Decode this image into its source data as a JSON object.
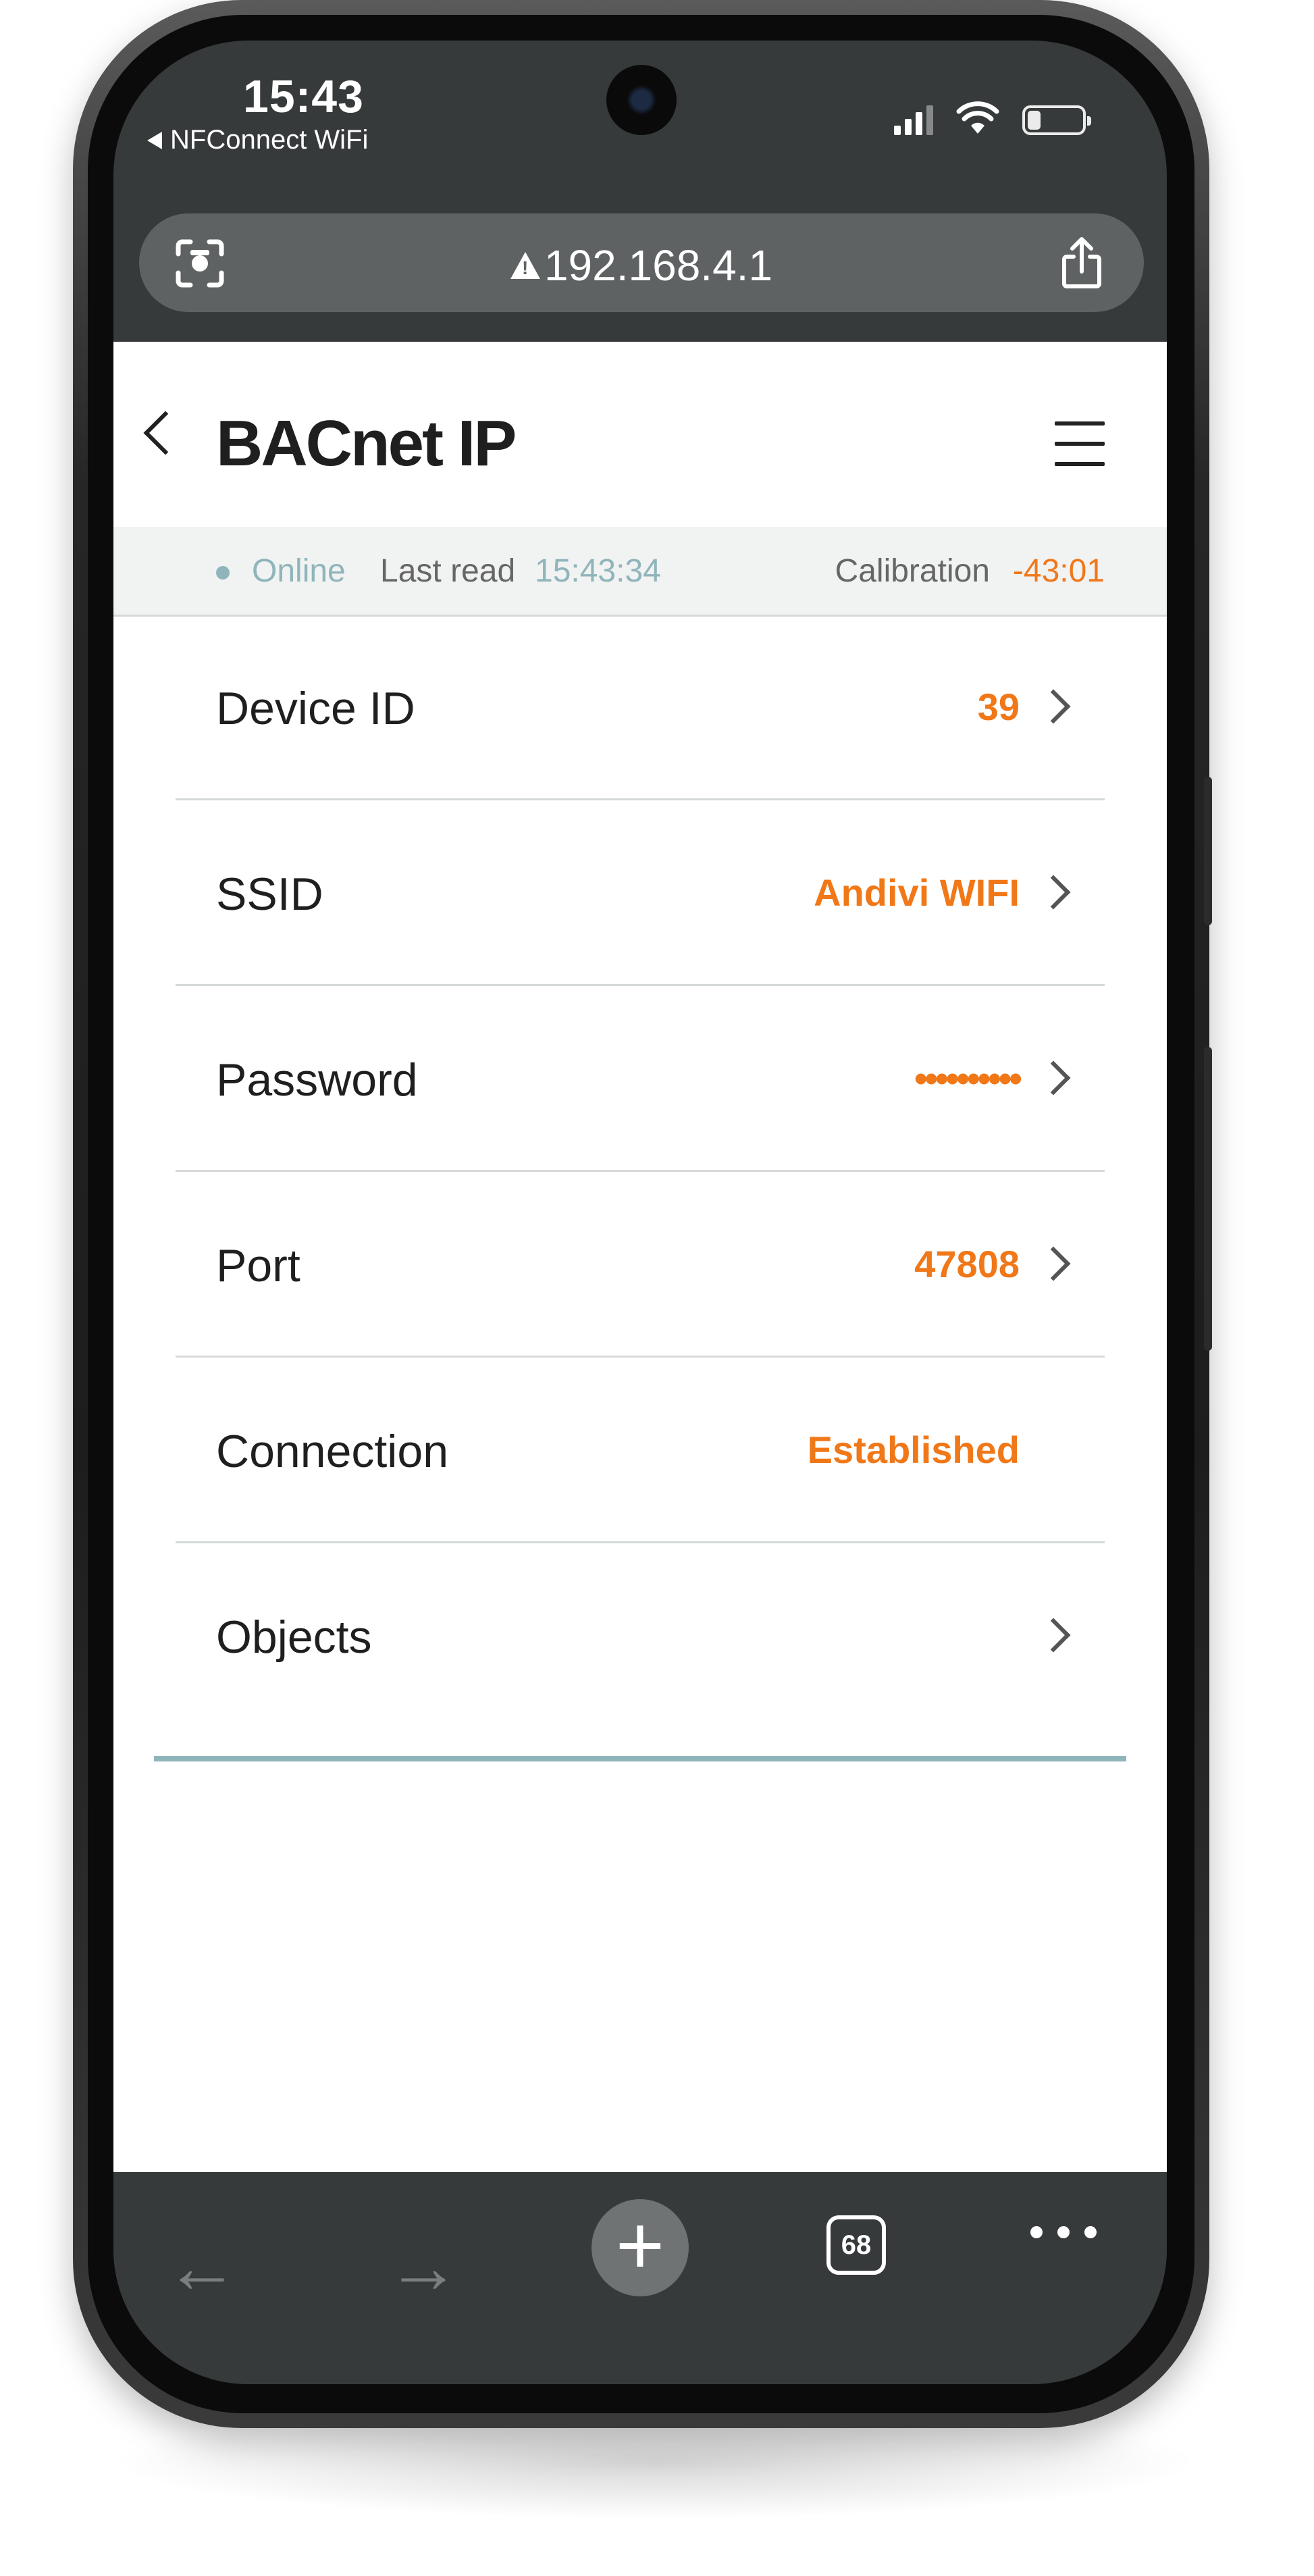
{
  "status_bar": {
    "time": "15:43",
    "back_app": "NFConnect WiFi"
  },
  "browser": {
    "url": "192.168.4.1",
    "tab_count": "68"
  },
  "header": {
    "title": "BACnet IP"
  },
  "status_line": {
    "state": "Online",
    "last_read_label": "Last read",
    "last_read_value": "15:43:34",
    "calibration_label": "Calibration",
    "calibration_value": "-43:01"
  },
  "settings": [
    {
      "label": "Device ID",
      "value": "39",
      "has_chevron": true
    },
    {
      "label": "SSID",
      "value": "Andivi WIFI",
      "has_chevron": true
    },
    {
      "label": "Password",
      "value": "••••••••••",
      "has_chevron": true
    },
    {
      "label": "Port",
      "value": "47808",
      "has_chevron": true
    },
    {
      "label": "Connection",
      "value": "Established",
      "has_chevron": false
    },
    {
      "label": "Objects",
      "value": "",
      "has_chevron": true
    }
  ],
  "colors": {
    "accent": "#f07818",
    "teal": "#8fb5bb",
    "chrome": "#363a3b"
  }
}
